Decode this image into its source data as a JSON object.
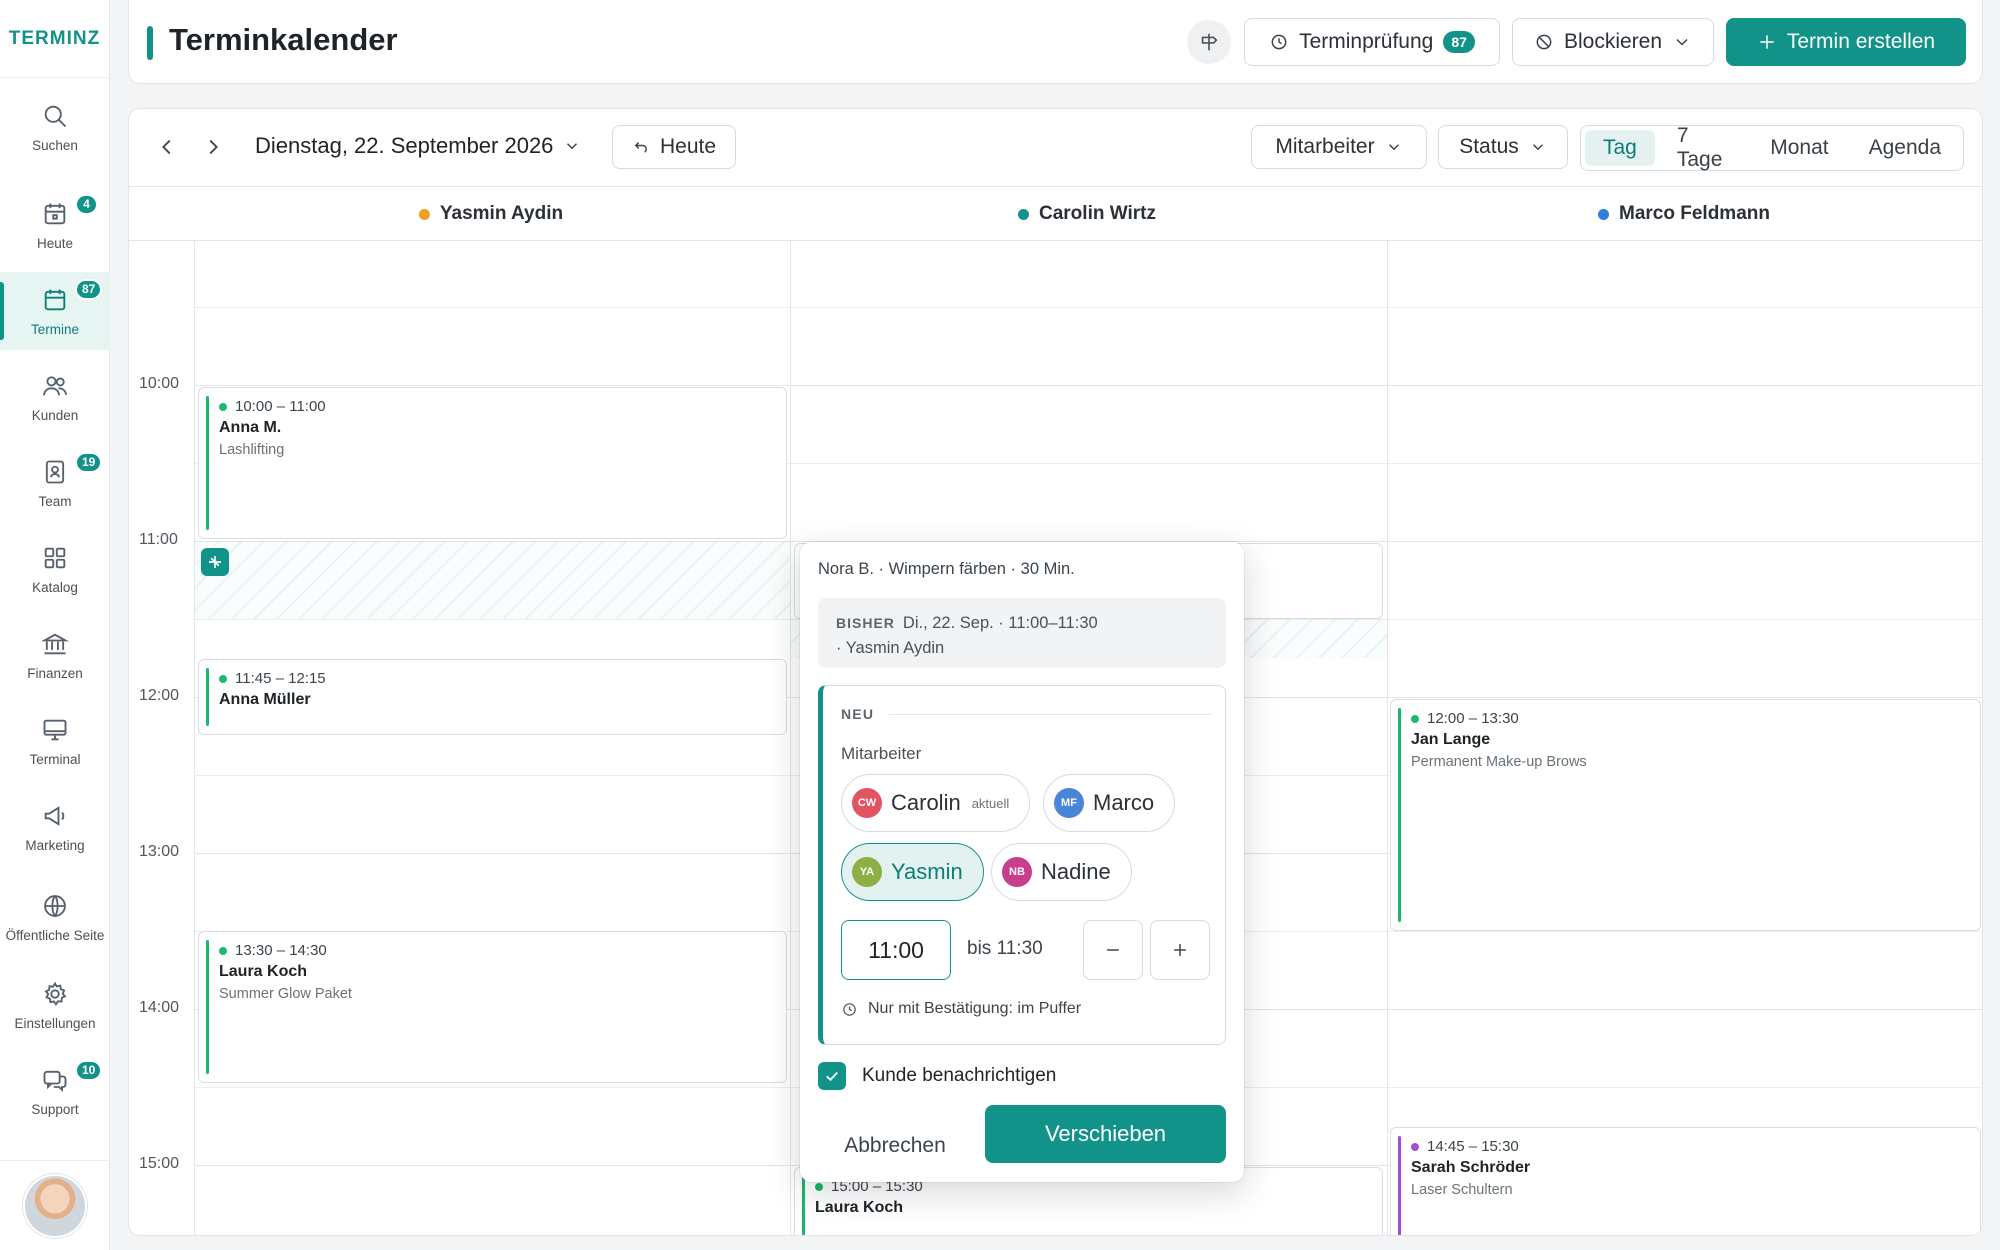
{
  "app": {
    "logo": "TERMINZ"
  },
  "sidebar": {
    "items": [
      {
        "label": "Suchen",
        "icon": "search-icon"
      },
      {
        "label": "Heute",
        "icon": "calendar-today-icon",
        "badge": "4"
      },
      {
        "label": "Termine",
        "icon": "calendar-icon",
        "badge": "87",
        "active": true
      },
      {
        "label": "Kunden",
        "icon": "users-icon"
      },
      {
        "label": "Team",
        "icon": "id-badge-icon",
        "badge": "19"
      },
      {
        "label": "Katalog",
        "icon": "grid-icon"
      },
      {
        "label": "Finanzen",
        "icon": "bank-icon"
      },
      {
        "label": "Terminal",
        "icon": "monitor-icon"
      },
      {
        "label": "Marketing",
        "icon": "megaphone-icon"
      },
      {
        "label": "Öffentliche Seite",
        "icon": "globe-icon"
      },
      {
        "label": "Einstellungen",
        "icon": "gear-icon"
      },
      {
        "label": "Support",
        "icon": "chat-icon",
        "badge": "10"
      }
    ]
  },
  "header": {
    "title": "Terminkalender",
    "review_label": "Terminprüfung",
    "review_count": "87",
    "block_label": "Blockieren",
    "create_label": "Termin erstellen",
    "accent": "#12938a"
  },
  "toolbar": {
    "date": "Dienstag, 22. September 2026",
    "today_label": "Heute",
    "filter_staff": "Mitarbeiter",
    "filter_status": "Status",
    "views": [
      "Tag",
      "7 Tage",
      "Monat",
      "Agenda"
    ],
    "active_view": "Tag"
  },
  "columns": [
    {
      "name": "Yasmin Aydin",
      "color": "#f0a020"
    },
    {
      "name": "Carolin Wirtz",
      "color": "#12938a"
    },
    {
      "name": "Marco Feldmann",
      "color": "#2f7de1"
    }
  ],
  "times": [
    "10:00",
    "11:00",
    "12:00",
    "13:00",
    "14:00",
    "15:00"
  ],
  "events": [
    {
      "time": "10:00 – 11:00",
      "name": "Anna M.",
      "service": "Lashlifting"
    },
    {
      "time": "11:45 – 12:15",
      "name": "Anna Müller",
      "service": ""
    },
    {
      "time": "13:30 – 14:30",
      "name": "Laura Koch",
      "service": "Summer Glow Paket"
    },
    {
      "time": "12:00 – 13:30",
      "name": "Jan Lange",
      "service": "Permanent Make-up Brows"
    },
    {
      "time": "14:45 – 15:30",
      "name": "Sarah Schröder",
      "service": "Laser Schultern"
    },
    {
      "time": "15:00 – 15:30",
      "name": "Laura Koch",
      "service": ""
    }
  ],
  "popover": {
    "title": "Nora B. · Wimpern färben · 30 Min.",
    "previous_label": "BISHER",
    "previous_value": "Di., 22. Sep. · 11:00–11:30",
    "previous_staff": "· Yasmin Aydin",
    "new_label": "NEU",
    "staff_label": "Mitarbeiter",
    "staff_options": [
      {
        "initials": "CW",
        "name": "Carolin",
        "tag": "aktuell",
        "color": "#e05561"
      },
      {
        "initials": "MF",
        "name": "Marco",
        "tag": "",
        "color": "#4a86d8"
      },
      {
        "initials": "YA",
        "name": "Yasmin",
        "tag": "",
        "color": "#8cb043"
      },
      {
        "initials": "NB",
        "name": "Nadine",
        "tag": "",
        "color": "#c93d8f"
      }
    ],
    "selected_staff": "Yasmin",
    "start_time": "11:00",
    "end_text": "bis 11:30",
    "buffer_note": "Nur mit Bestätigung: im Puffer",
    "notify_label": "Kunde benachrichtigen",
    "notify_checked": true,
    "cancel_label": "Abbrechen",
    "confirm_label": "Verschieben"
  }
}
